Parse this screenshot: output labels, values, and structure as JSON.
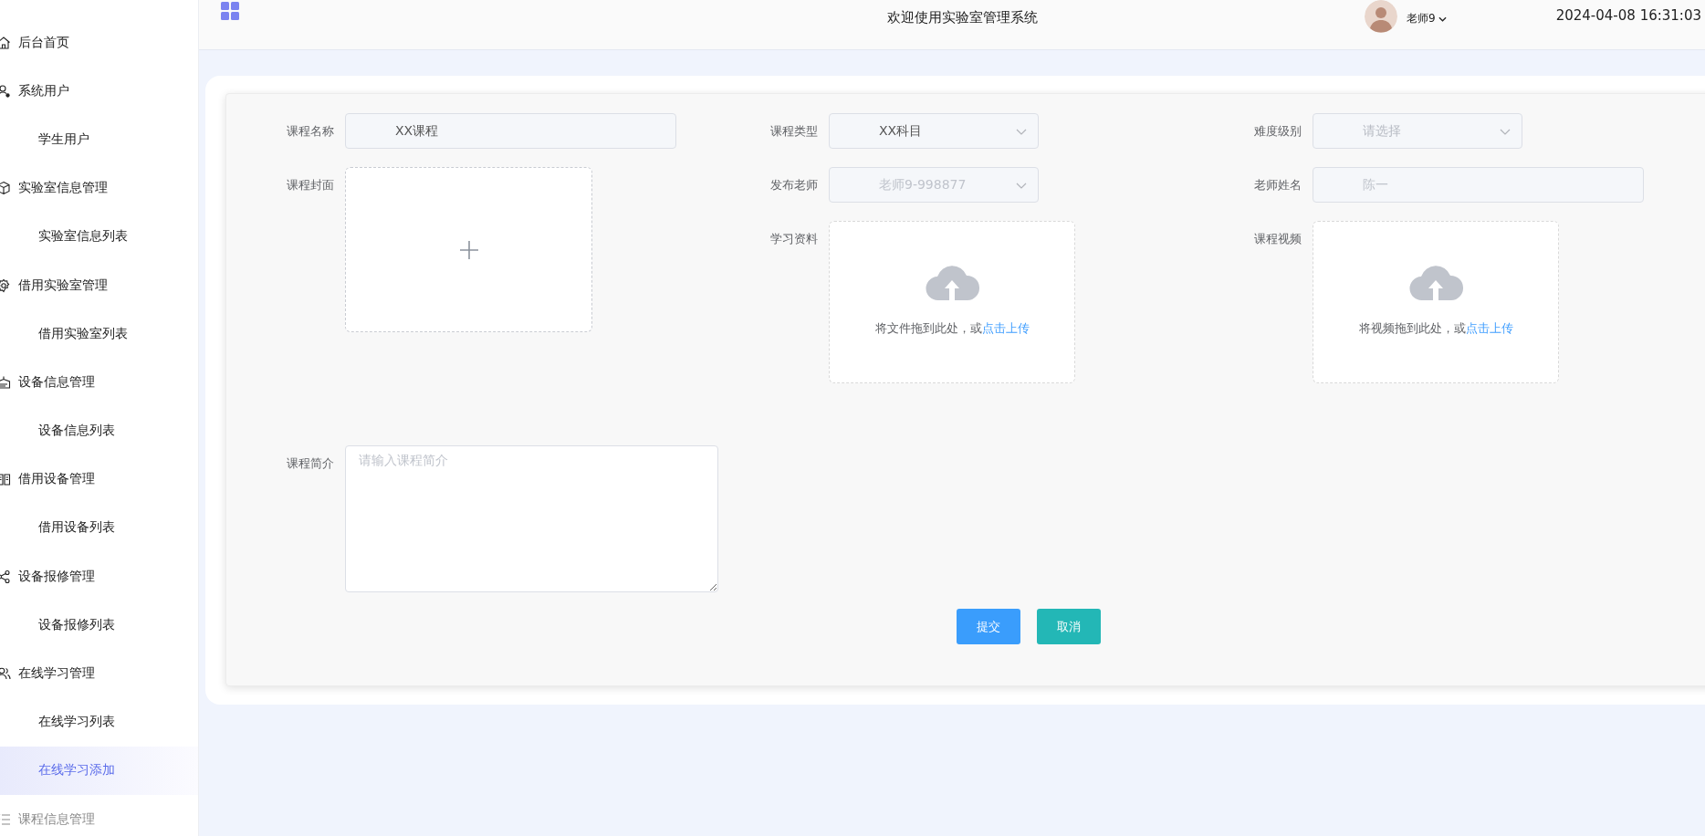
{
  "top_bar": {
    "title": "欢迎使用实验室管理系统",
    "user": "老师9",
    "datetime": "2024-04-08 16:31:03"
  },
  "sidebar": {
    "items": [
      {
        "label": "后台首页",
        "disabled": false
      },
      {
        "label": "系统用户",
        "disabled": false,
        "children": [
          {
            "label": "学生用户",
            "selected": false
          }
        ]
      },
      {
        "label": "实验室信息管理",
        "disabled": false,
        "children": [
          {
            "label": "实验室信息列表",
            "selected": false
          }
        ]
      },
      {
        "label": "借用实验室管理",
        "disabled": false,
        "children": [
          {
            "label": "借用实验室列表",
            "selected": false
          }
        ]
      },
      {
        "label": "设备信息管理",
        "disabled": false,
        "children": [
          {
            "label": "设备信息列表",
            "selected": false
          }
        ]
      },
      {
        "label": "借用设备管理",
        "disabled": false,
        "children": [
          {
            "label": "借用设备列表",
            "selected": false
          }
        ]
      },
      {
        "label": "设备报修管理",
        "disabled": false,
        "children": [
          {
            "label": "设备报修列表",
            "selected": false
          }
        ]
      },
      {
        "label": "在线学习管理",
        "disabled": false,
        "children": [
          {
            "label": "在线学习列表",
            "selected": false
          },
          {
            "label": "在线学习添加",
            "selected": true
          }
        ]
      },
      {
        "label": "课程信息管理",
        "disabled": true
      }
    ]
  },
  "form": {
    "fields": [
      {
        "kind": "text",
        "label": "课程名称",
        "value": "XX课程",
        "disabled": false
      },
      {
        "kind": "select",
        "label": "课程类型",
        "value": "XX科目",
        "disabled": false
      },
      {
        "kind": "select",
        "label": "难度级别",
        "placeholder": "请选择"
      },
      {
        "kind": "image_upload",
        "label": "课程封面"
      },
      {
        "kind": "select",
        "label": "发布老师",
        "value": "老师9-998877",
        "disabled": true
      },
      {
        "kind": "text",
        "label": "老师姓名",
        "value": "陈一",
        "disabled": true
      },
      {
        "kind": "upload",
        "label": "学习资料",
        "hint": "将文件拖到此处，或",
        "link": "点击上传"
      },
      {
        "kind": "upload",
        "label": "课程视频",
        "hint": "将视频拖到此处，或",
        "link": "点击上传"
      },
      {
        "kind": "textarea",
        "label": "课程简介",
        "placeholder": "请输入课程简介"
      }
    ],
    "buttons": [
      {
        "label": "提交",
        "kind": "primary"
      },
      {
        "label": "取消",
        "kind": "secondary"
      }
    ]
  }
}
